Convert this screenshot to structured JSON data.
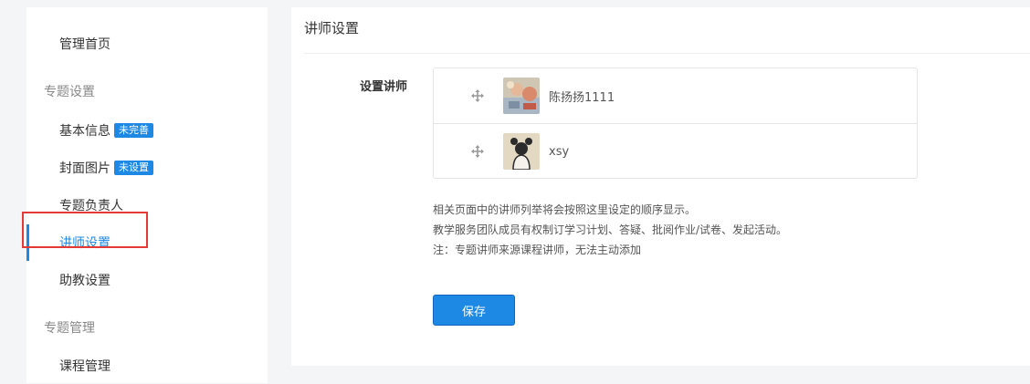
{
  "sidebar": {
    "items": [
      {
        "label": "管理首页",
        "type": "item"
      },
      {
        "label": "专题设置",
        "type": "group"
      },
      {
        "label": "基本信息",
        "type": "item",
        "badge": "未完善"
      },
      {
        "label": "封面图片",
        "type": "item",
        "badge": "未设置"
      },
      {
        "label": "专题负责人",
        "type": "item"
      },
      {
        "label": "讲师设置",
        "type": "item",
        "active": true
      },
      {
        "label": "助教设置",
        "type": "item"
      },
      {
        "label": "专题管理",
        "type": "group"
      },
      {
        "label": "课程管理",
        "type": "item"
      }
    ]
  },
  "main": {
    "title": "讲师设置",
    "field_label": "设置讲师",
    "teachers": [
      {
        "name": "陈扬扬1111",
        "avatar_icon": "photo-avatar"
      },
      {
        "name": "xsy",
        "avatar_icon": "cartoon-avatar"
      }
    ],
    "notes": [
      "相关页面中的讲师列举将会按照这里设定的顺序显示。",
      "教学服务团队成员有权制订学习计划、答疑、批阅作业/试卷、发起活动。",
      "注：专题讲师来源课程讲师，无法主动添加"
    ],
    "save_label": "保存"
  },
  "colors": {
    "accent": "#1e88e5",
    "highlight": "#e53935",
    "background": "#f4f5f7"
  }
}
